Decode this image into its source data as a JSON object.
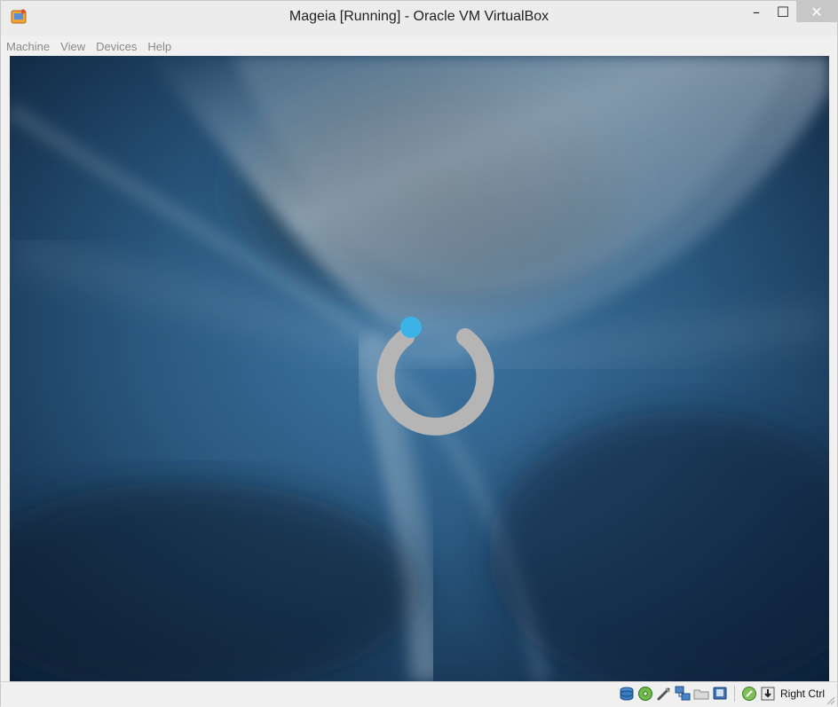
{
  "window": {
    "title": "Mageia [Running] - Oracle VM VirtualBox",
    "controls": {
      "minimize": "–",
      "maximize": "☐",
      "close": "✕"
    }
  },
  "menu": {
    "items": [
      {
        "label": "Machine"
      },
      {
        "label": "View"
      },
      {
        "label": "Devices"
      },
      {
        "label": "Help"
      }
    ]
  },
  "guest_screen": {
    "content": "mageia-boot-splash",
    "logo_icon": "mageia-logo-icon",
    "colors": {
      "bg_dark": "#0e2440",
      "bg_mid": "#2f5f86",
      "logo_ring": "#b7b7b7",
      "logo_dot": "#3bb3e6"
    }
  },
  "statusbar": {
    "icons": [
      "hard-disk-icon",
      "optical-drive-icon",
      "usb-icon",
      "network-icon",
      "shared-folders-icon",
      "display-icon",
      "mouse-integration-icon",
      "keyboard-capture-icon"
    ],
    "host_key": "Right Ctrl"
  }
}
